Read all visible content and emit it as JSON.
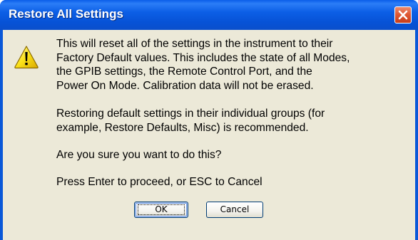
{
  "window": {
    "title": "Restore All Settings",
    "close_icon": "close-icon"
  },
  "dialog": {
    "icon": "warning-icon",
    "message": {
      "line1": "This will reset all of the settings in the instrument to their",
      "line2": "Factory Default values.  This includes the state of all Modes,",
      "line3": "the GPIB settings, the Remote Control Port, and the",
      "line4": "Power On Mode.  Calibration data will not be erased.",
      "line5": "Restoring default settings in their individual groups (for",
      "line6": "example, Restore Defaults, Misc) is recommended.",
      "line7": "Are you sure you want to do this?",
      "line8": "Press Enter to proceed, or ESC to Cancel"
    }
  },
  "buttons": {
    "ok_label": "OK",
    "cancel_label": "Cancel"
  },
  "colors": {
    "titlebar": "#0a58d8",
    "client_background": "#ece9d8",
    "close_button": "#e05a36",
    "warning_yellow": "#fbe219"
  }
}
